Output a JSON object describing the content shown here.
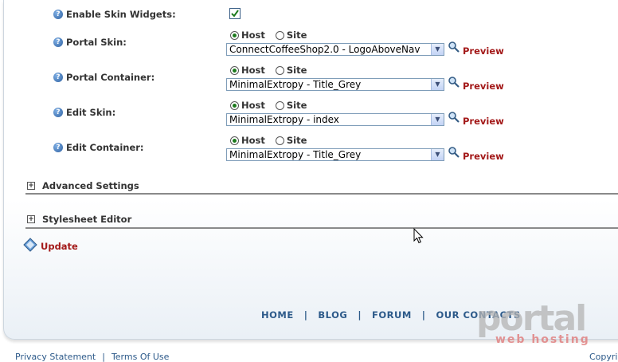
{
  "settings": {
    "enable_skin_widgets": {
      "label": "Enable Skin Widgets:",
      "checked": true
    },
    "rows": [
      {
        "label": "Portal Skin:",
        "host_label": "Host",
        "site_label": "Site",
        "selected": "host",
        "value": "ConnectCoffeeShop2.0 - LogoAboveNav",
        "preview": "Preview"
      },
      {
        "label": "Portal Container:",
        "host_label": "Host",
        "site_label": "Site",
        "selected": "host",
        "value": "MinimalExtropy - Title_Grey",
        "preview": "Preview"
      },
      {
        "label": "Edit Skin:",
        "host_label": "Host",
        "site_label": "Site",
        "selected": "host",
        "value": "MinimalExtropy - index",
        "preview": "Preview"
      },
      {
        "label": "Edit Container:",
        "host_label": "Host",
        "site_label": "Site",
        "selected": "host",
        "value": "MinimalExtropy - Title_Grey",
        "preview": "Preview"
      }
    ]
  },
  "sections": {
    "advanced": "Advanced Settings",
    "stylesheet": "Stylesheet Editor"
  },
  "update_label": "Update",
  "footer_nav": [
    "HOME",
    "BLOG",
    "FORUM",
    "OUR CONTACTS"
  ],
  "footer_sep": "|",
  "watermark": {
    "main": "portal",
    "sub": "web hosting"
  },
  "bottom_links": {
    "privacy": "Privacy Statement",
    "sep": "|",
    "terms": "Terms Of Use",
    "copyright": "Copyri"
  },
  "colors": {
    "link_red": "#a31919",
    "nav_blue": "#2d5a8a",
    "check_green": "#1d7a1d"
  }
}
